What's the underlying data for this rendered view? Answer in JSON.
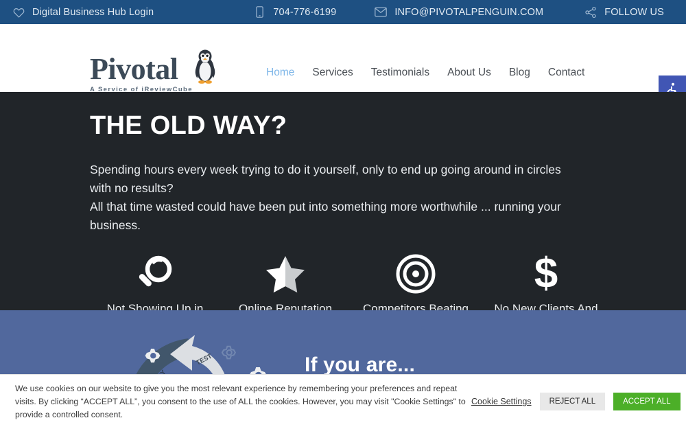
{
  "topbar": {
    "login": {
      "label": "Digital Business Hub Login",
      "icon": "heart-icon"
    },
    "phone": {
      "label": "704-776-6199",
      "icon": "mobile-phone-icon"
    },
    "email": {
      "label": "INFO@PIVOTALPENGUIN.COM",
      "icon": "envelope-icon"
    },
    "follow": {
      "label": "FOLLOW US",
      "icon": "share-icon"
    },
    "bg_color": "#1e5082"
  },
  "header": {
    "logo": {
      "word": "Pivotal",
      "tagline": "A Service of iReviewCube",
      "mascot": "penguin-icon"
    },
    "nav": [
      {
        "label": "Home",
        "active": true
      },
      {
        "label": "Services",
        "active": false
      },
      {
        "label": "Testimonials",
        "active": false
      },
      {
        "label": "About Us",
        "active": false
      },
      {
        "label": "Blog",
        "active": false
      },
      {
        "label": "Contact",
        "active": false
      }
    ],
    "active_color": "#7eb6e8",
    "accessibility_button": {
      "icon": "wheelchair-accessibility-icon",
      "color": "#4156b4"
    },
    "shortcode": "[rev_slider slider-1-1]"
  },
  "hero": {
    "bg_color": "#212529",
    "heading": "THE OLD WAY?",
    "paragraph_line1": "Spending hours every week trying to do it yourself, only to end up going around in circles",
    "paragraph_line2": "with no results?",
    "paragraph_line3": "All that time wasted could have been put into something more worthwhile ... running your",
    "paragraph_line4": "business.",
    "features": [
      {
        "icon": "magnifying-glass-icon",
        "label": "Not Showing Up in Searches"
      },
      {
        "icon": "half-star-icon",
        "label": "Online Reputation Issues"
      },
      {
        "icon": "bullseye-target-icon",
        "label": "Competitors Beating You"
      },
      {
        "icon": "dollar-sign-icon",
        "label": "No New Clients And Sales"
      }
    ]
  },
  "blue_section": {
    "bg_color": "#51689d",
    "heading": "If you are...",
    "graphic": {
      "name": "devops-cycle-illustration",
      "labels": [
        "DEPLOY",
        "TEST"
      ],
      "accent_color": "#fa6450"
    }
  },
  "cookie_banner": {
    "text": "We use cookies on our website to give you the most relevant experience by remembering your preferences and repeat visits. By clicking “ACCEPT ALL”, you consent to the use of ALL the cookies. However, you may visit \"Cookie Settings\" to provide a controlled consent.",
    "settings_link": "Cookie Settings",
    "reject_label": "REJECT ALL",
    "accept_label": "ACCEPT ALL",
    "accept_color": "#4caf28"
  }
}
